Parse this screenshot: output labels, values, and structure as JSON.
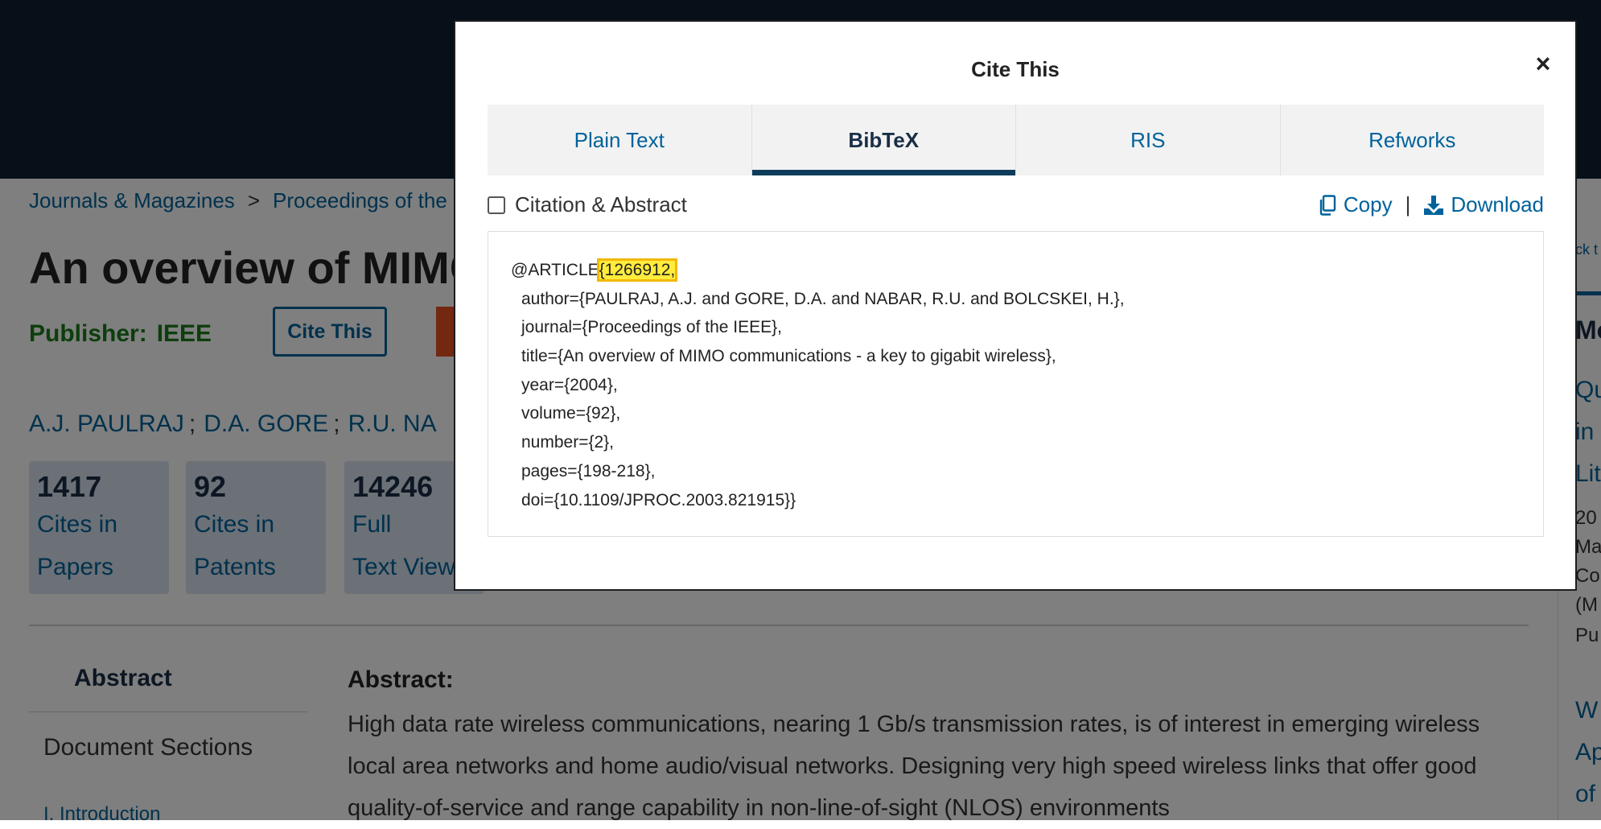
{
  "background": {
    "breadcrumb": [
      "Journals & Magazines",
      ">",
      "Proceedings of the"
    ],
    "title": "An overview of MIMC",
    "publisher_label": "Publisher:",
    "publisher_value": "IEEE",
    "cite_button": "Cite This",
    "authors": [
      "A.J. PAULRAJ",
      "D.A. GORE",
      "R.U. NA"
    ],
    "author_separator": ";",
    "metrics": [
      {
        "value": "1417",
        "line1": "Cites in",
        "line2": "Papers"
      },
      {
        "value": "92",
        "line1": "Cites in",
        "line2": "Patents"
      },
      {
        "value": "14246",
        "line1": "Full",
        "line2": "Text View"
      }
    ],
    "sidebar": {
      "abstract": "Abstract",
      "document_sections": "Document Sections",
      "intro": "I. Introduction"
    },
    "abstract_heading": "Abstract:",
    "abstract_text": "High data rate wireless communications, nearing 1 Gb/s transmission rates, is of interest in emerging wireless local area networks and home audio/visual networks. Designing very high speed wireless links that offer good quality-of-service and range capability in non-line-of-sight (NLOS) environments",
    "right_col": {
      "back_link": "ck t",
      "head": "Mo",
      "link1_lines": [
        "Qu",
        "in",
        "Lit"
      ],
      "meta_lines": [
        "20",
        "Ma",
        "Co",
        "(M"
      ],
      "pub": "Pu",
      "link2_lines": [
        "W",
        "Ap",
        "of"
      ]
    }
  },
  "modal": {
    "title": "Cite This",
    "close_symbol": "×",
    "tabs": [
      "Plain Text",
      "BibTeX",
      "RIS",
      "Refworks"
    ],
    "active_tab": "BibTeX",
    "checkbox_label": "Citation & Abstract",
    "copy_label": "Copy",
    "separator": "|",
    "download_label": "Download",
    "bibtex": {
      "prefix": "@ARTICLE",
      "key_highlighted": "{1266912,",
      "fields": [
        "author={PAULRAJ, A.J. and GORE, D.A. and NABAR, R.U. and BOLCSKEI, H.},",
        "journal={Proceedings of the IEEE},",
        "title={An overview of MIMO communications - a key to gigabit wireless},",
        "year={2004},",
        "volume={92},",
        "number={2},",
        "pages={198-218},",
        "doi={10.1109/JPROC.2003.821915}}"
      ]
    }
  },
  "colors": {
    "link": "#00629b",
    "header_dark": "#0e2030",
    "publisher_green": "#1b7d1b",
    "highlight": "#ffec3d",
    "pdf_orange": "#e55022"
  }
}
